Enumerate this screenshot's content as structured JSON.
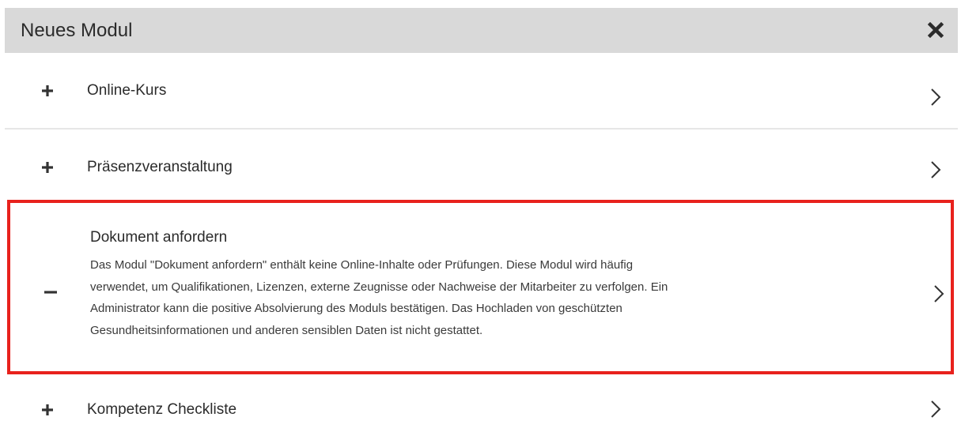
{
  "dialog": {
    "title": "Neues Modul"
  },
  "icons": {
    "close": "close-icon",
    "expand": "plus-icon",
    "collapse": "minus-icon",
    "chevron": "chevron-right-icon"
  },
  "colors": {
    "header_bg": "#d9d9d9",
    "highlight_border": "#e8211c",
    "text": "#2b2b2b"
  },
  "modules": [
    {
      "label": "Online-Kurs",
      "expanded": false
    },
    {
      "label": "Präsenzveranstaltung",
      "expanded": false
    },
    {
      "label": "Dokument anfordern",
      "expanded": true,
      "description_lines": [
        "Das Modul \"Dokument anfordern\" enthält keine Online-Inhalte oder Prüfungen. Diese Modul wird häufig",
        "verwendet, um Qualifikationen, Lizenzen, externe Zeugnisse oder Nachweise der Mitarbeiter zu verfolgen. Ein",
        "Administrator kann die positive Absolvierung des Moduls bestätigen. Das Hochladen von geschützten",
        "Gesundheitsinformationen und anderen sensiblen Daten ist nicht gestattet."
      ]
    },
    {
      "label": "Kompetenz Checkliste",
      "expanded": false
    }
  ]
}
